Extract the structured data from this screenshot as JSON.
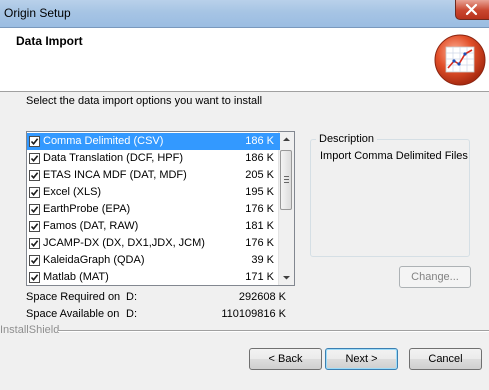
{
  "window": {
    "title": "Origin Setup"
  },
  "header": {
    "title": "Data Import"
  },
  "instruction": "Select the data import options you want to install",
  "items": [
    {
      "name": "Comma Delimited (CSV)",
      "size": "186 K",
      "checked": true,
      "selected": true
    },
    {
      "name": "Data Translation (DCF, HPF)",
      "size": "186 K",
      "checked": true,
      "selected": false
    },
    {
      "name": "ETAS INCA MDF (DAT, MDF)",
      "size": "205 K",
      "checked": true,
      "selected": false
    },
    {
      "name": "Excel (XLS)",
      "size": "195 K",
      "checked": true,
      "selected": false
    },
    {
      "name": "EarthProbe (EPA)",
      "size": "176 K",
      "checked": true,
      "selected": false
    },
    {
      "name": "Famos (DAT, RAW)",
      "size": "181 K",
      "checked": true,
      "selected": false
    },
    {
      "name": "JCAMP-DX (DX, DX1,JDX, JCM)",
      "size": "176 K",
      "checked": true,
      "selected": false
    },
    {
      "name": "KaleidaGraph (QDA)",
      "size": "39 K",
      "checked": true,
      "selected": false
    },
    {
      "name": "Matlab (MAT)",
      "size": "171 K",
      "checked": true,
      "selected": false
    }
  ],
  "description": {
    "label": "Description",
    "text": "Import Comma Delimited Files"
  },
  "change_label": "Change...",
  "space": {
    "required_label": "Space Required on",
    "required_drive": "D:",
    "required_value": "292608 K",
    "available_label": "Space Available on",
    "available_drive": "D:",
    "available_value": "110109816 K"
  },
  "installshield": "InstallShield",
  "buttons": {
    "back": "< Back",
    "next": "Next >",
    "cancel": "Cancel"
  },
  "colors": {
    "selection": "#3399ff",
    "titlebar": "#a6c4e4",
    "close": "#c9462e"
  },
  "icons": {
    "logo": "graph-logo-icon",
    "check": "check-icon",
    "close": "close-icon"
  }
}
